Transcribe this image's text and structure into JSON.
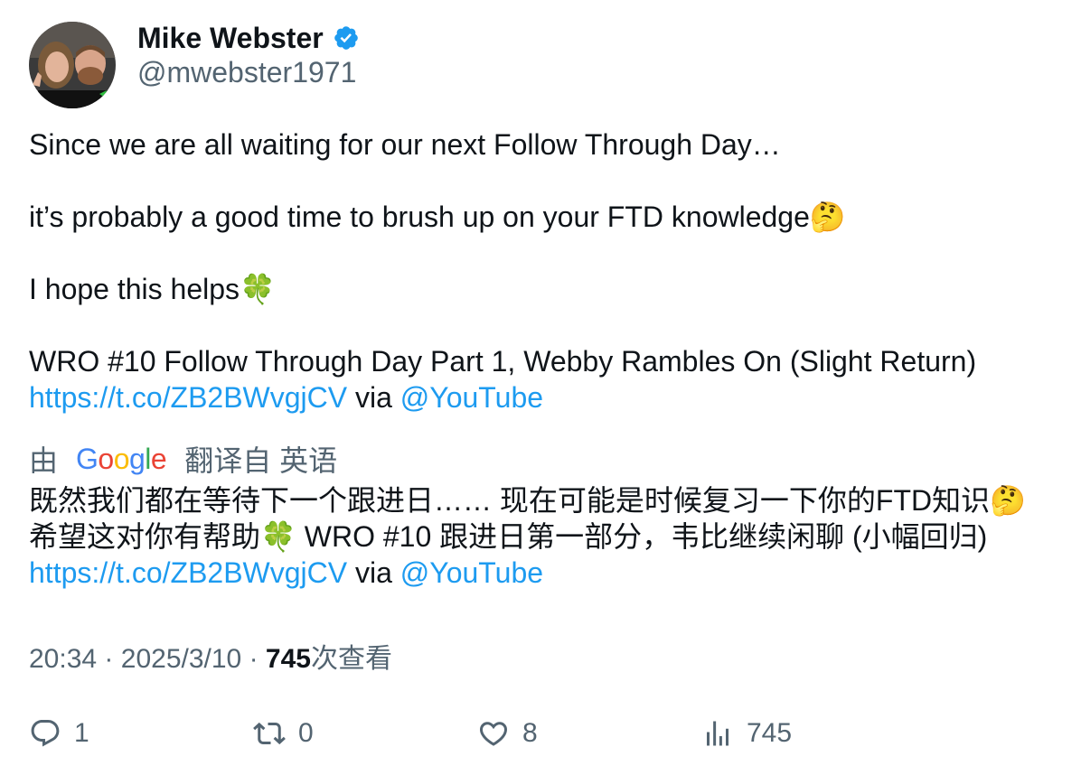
{
  "author": {
    "name": "Mike Webster",
    "handle": "@mwebster1971",
    "verified_color": "#1d9bf0"
  },
  "tweet": {
    "line1": "Since we are all waiting for our next Follow Through Day…",
    "line2_text": "it’s probably a good time to brush up on your FTD knowledge",
    "line2_emoji": "🤔",
    "line3_text": "I hope this helps",
    "line3_emoji": "🍀",
    "line4": "WRO #10 Follow Through Day Part 1, Webby Rambles On (Slight Return)",
    "link": "https://t.co/ZB2BWvgjCV",
    "via": "via",
    "mention": "@YouTube"
  },
  "translation": {
    "by_prefix": "由",
    "provider": "Google",
    "by_suffix": "翻译自 英语",
    "line1_text": "既然我们都在等待下一个跟进日…… 现在可能是时候复习一下你的FTD知识",
    "line1_emoji": "🤔",
    "line2_text_a": "希望这对你有帮助",
    "line2_emoji": "🍀",
    "line2_text_b": " WRO #10 跟进日第一部分，韦比继续闲聊 (小幅回归)",
    "link": "https://t.co/ZB2BWvgjCV",
    "via": "via",
    "mention": "@YouTube"
  },
  "meta": {
    "time": "20:34",
    "separator": "·",
    "date": "2025/3/10",
    "views_count": "745",
    "views_label": "次查看"
  },
  "actions": {
    "replies": "1",
    "retweets": "0",
    "likes": "8",
    "views": "745"
  },
  "colors": {
    "link": "#1d9bf0",
    "secondary_text": "#536471",
    "primary_text": "#0f1419"
  }
}
